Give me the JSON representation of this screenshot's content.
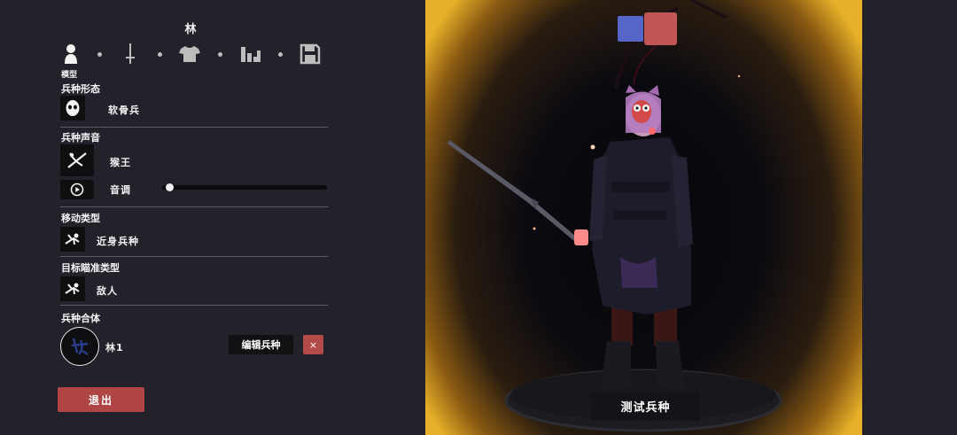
{
  "unit": {
    "name": "林"
  },
  "tabs": [
    {
      "icon": "person-icon",
      "label": "模型",
      "active": true
    },
    {
      "icon": "sword-icon"
    },
    {
      "icon": "shirt-icon"
    },
    {
      "icon": "bars-icon"
    },
    {
      "icon": "save-icon"
    }
  ],
  "sections": {
    "form": {
      "title": "兵种形态",
      "value": "软骨兵"
    },
    "voice": {
      "title": "兵种声音",
      "value": "猴王",
      "pitch_label": "音调",
      "pitch_level": 0.02
    },
    "move": {
      "title": "移动类型",
      "value": "近身兵种"
    },
    "target": {
      "title": "目标瞄准类型",
      "value": "敌人"
    },
    "merge": {
      "title": "兵种合体",
      "value": "林1",
      "edit_label": "编辑兵种",
      "close_label": "×"
    }
  },
  "buttons": {
    "exit_label": "退出",
    "test_label": "测试兵种"
  },
  "team_colors": {
    "blue": "#5565c8",
    "red": "#c25555"
  },
  "colors": {
    "panel_bg": "#23222b",
    "accent_red": "#b04545",
    "glow": "#e6b028"
  }
}
